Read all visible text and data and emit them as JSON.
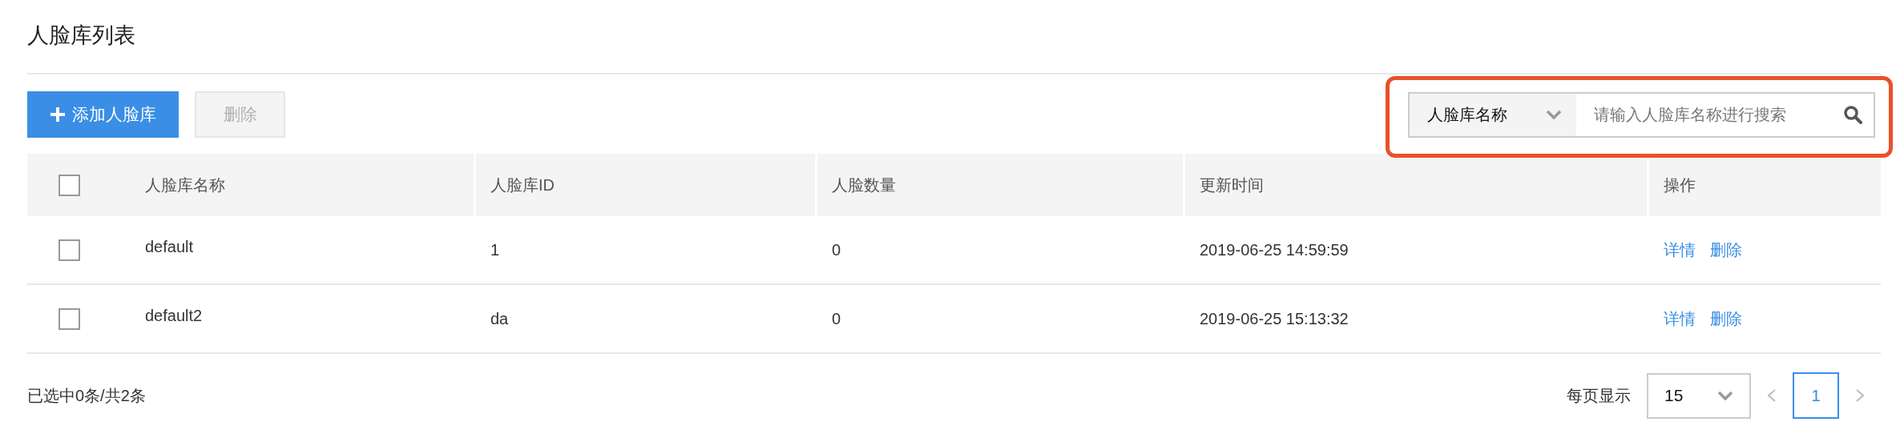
{
  "page": {
    "title": "人脸库列表"
  },
  "toolbar": {
    "buttons": [
      {
        "label": "添加人脸库",
        "kind": "primary",
        "disabled": false
      },
      {
        "label": "删除",
        "kind": "plain",
        "disabled": true
      }
    ]
  },
  "search": {
    "highlighted": true,
    "field": "人脸库名称",
    "placeholder": "请输入人脸库名称进行搜索"
  },
  "table": {
    "select_all": {
      "checked": false
    },
    "columns": [
      "人脸库名称",
      "人脸库ID",
      "人脸数量",
      "更新时间",
      "操作"
    ],
    "rows": [
      {
        "selected": false,
        "cells": [
          "default",
          "1",
          "0",
          "2019-06-25 14:59:59"
        ],
        "actions": [
          "详情",
          "删除"
        ]
      },
      {
        "selected": false,
        "cells": [
          "default2",
          "da",
          "0",
          "2019-06-25 15:13:32"
        ],
        "actions": [
          "详情",
          "删除"
        ]
      }
    ]
  },
  "footer": {
    "summary": "已选中0条/共2条",
    "page_size_label": "每页显示",
    "page_size": "15",
    "pages": [
      {
        "label": "1",
        "selected": true
      }
    ]
  }
}
